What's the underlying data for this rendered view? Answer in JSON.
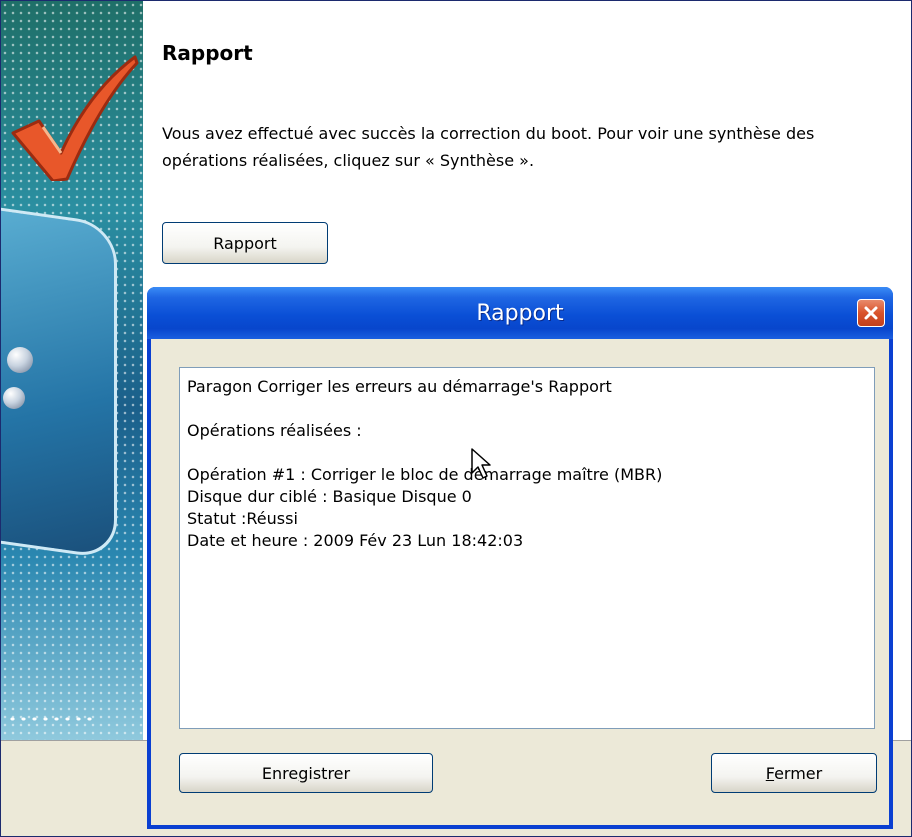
{
  "wizard": {
    "title": "Rapport",
    "description": "Vous avez effectué avec succès la correction du boot. Pour voir une synthèse des opérations réalisées, cliquez sur « Synthèse ».",
    "report_button_label": "Rapport"
  },
  "dialog": {
    "title": "Rapport",
    "close_icon": "close-icon",
    "report_lines": {
      "header": "Paragon Corriger les erreurs au démarrage's Rapport",
      "operations_heading": "Opérations réalisées :",
      "operation": "Opération #1 : Corriger le bloc de démarrage maître (MBR)",
      "target_disk": "Disque dur ciblé : Basique Disque 0",
      "status": "Statut :Réussi",
      "datetime": "Date et heure : 2009 Fév 23 Lun 18:42:03"
    },
    "save_button": {
      "label_pre": "Enre",
      "label_accel": "g",
      "label_post": "istrer"
    },
    "close_button_label": "Fermer"
  },
  "colors": {
    "titlebar_blue": "#0a4fd6",
    "close_red": "#d9532b",
    "dialog_face": "#ece9d8"
  }
}
